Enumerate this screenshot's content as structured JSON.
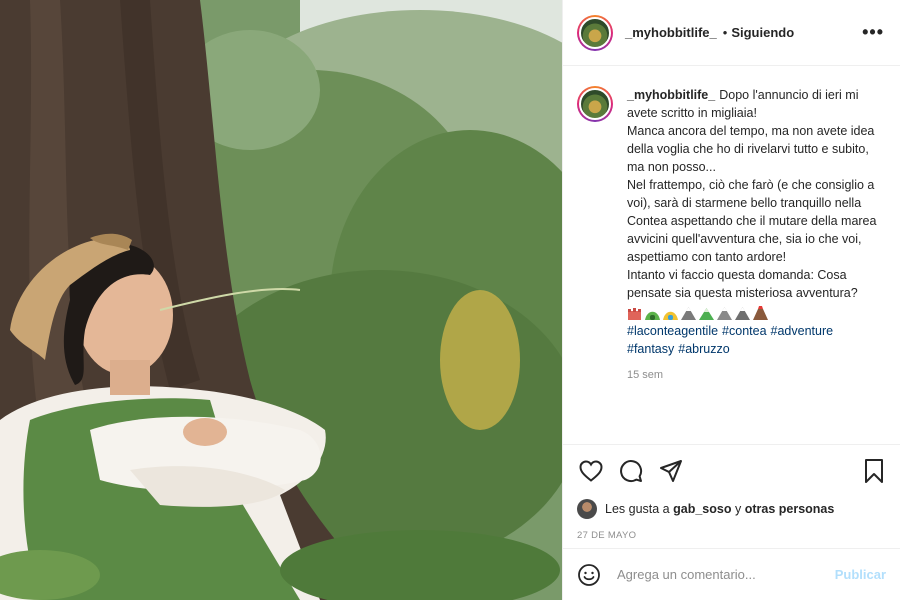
{
  "header": {
    "username": "_myhobbitlife_",
    "separator": "•",
    "follow_status": "Siguiendo",
    "more_label": "•••"
  },
  "caption": {
    "username": "_myhobbitlife_",
    "text": "Dopo l'annuncio di ieri mi avete scritto in migliaia!\nManca ancora del tempo, ma non avete idea della voglia che ho di rivelarvi tutto e subito, ma non posso...\nNel frattempo, ciò che farò (e che consiglio a voi), sarà di starmene bello tranquillo nella Contea aspettando che il mutare della marea avvicini quell'avventura che, sia io che voi, aspettiamo con tanto ardore!\nIntanto vi faccio questa domanda: Cosa pensate sia questa misteriosa avventura?",
    "emoji_icons": [
      "castle-emoji",
      "green-hill-emoji",
      "yellow-hill-emoji",
      "mountain-emoji",
      "green-hill-emoji",
      "mountain-emoji",
      "mountain-emoji",
      "volcano-emoji"
    ],
    "hashtags": [
      "#laconteagentile",
      "#contea",
      "#adventure",
      "#fantasy",
      "#abruzzo"
    ],
    "time_ago": "15 sem"
  },
  "likes": {
    "prefix": "Les gusta a",
    "user": "gab_soso",
    "conjunction": "y",
    "others": "otras personas"
  },
  "date": "27 DE MAYO",
  "comment": {
    "placeholder": "Agrega un comentario...",
    "publish_label": "Publicar"
  },
  "colors": {
    "link": "#00376b",
    "publish_disabled": "#b2dffc",
    "muted": "#8e8e8e"
  }
}
